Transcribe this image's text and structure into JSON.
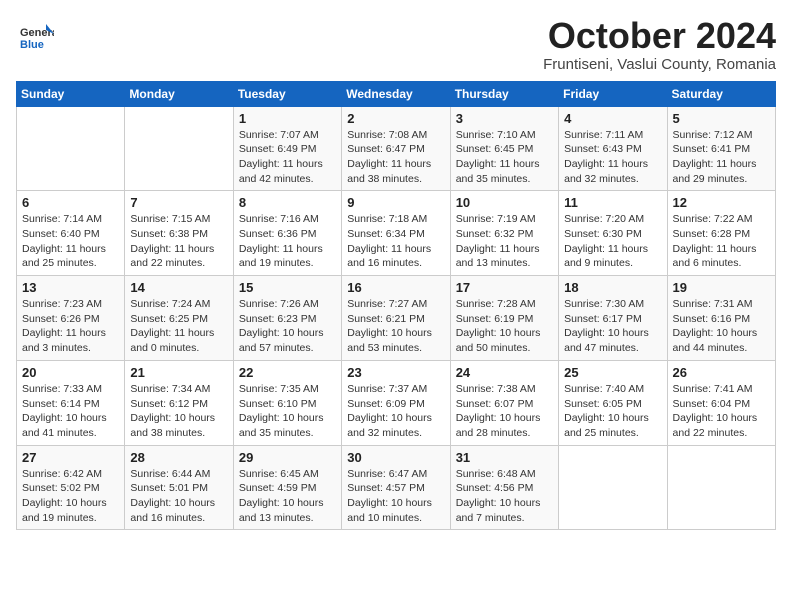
{
  "logo": {
    "general": "General",
    "blue": "Blue"
  },
  "header": {
    "month": "October 2024",
    "location": "Fruntiseni, Vaslui County, Romania"
  },
  "weekdays": [
    "Sunday",
    "Monday",
    "Tuesday",
    "Wednesday",
    "Thursday",
    "Friday",
    "Saturday"
  ],
  "weeks": [
    [
      {
        "day": "",
        "info": ""
      },
      {
        "day": "",
        "info": ""
      },
      {
        "day": "1",
        "info": "Sunrise: 7:07 AM\nSunset: 6:49 PM\nDaylight: 11 hours and 42 minutes."
      },
      {
        "day": "2",
        "info": "Sunrise: 7:08 AM\nSunset: 6:47 PM\nDaylight: 11 hours and 38 minutes."
      },
      {
        "day": "3",
        "info": "Sunrise: 7:10 AM\nSunset: 6:45 PM\nDaylight: 11 hours and 35 minutes."
      },
      {
        "day": "4",
        "info": "Sunrise: 7:11 AM\nSunset: 6:43 PM\nDaylight: 11 hours and 32 minutes."
      },
      {
        "day": "5",
        "info": "Sunrise: 7:12 AM\nSunset: 6:41 PM\nDaylight: 11 hours and 29 minutes."
      }
    ],
    [
      {
        "day": "6",
        "info": "Sunrise: 7:14 AM\nSunset: 6:40 PM\nDaylight: 11 hours and 25 minutes."
      },
      {
        "day": "7",
        "info": "Sunrise: 7:15 AM\nSunset: 6:38 PM\nDaylight: 11 hours and 22 minutes."
      },
      {
        "day": "8",
        "info": "Sunrise: 7:16 AM\nSunset: 6:36 PM\nDaylight: 11 hours and 19 minutes."
      },
      {
        "day": "9",
        "info": "Sunrise: 7:18 AM\nSunset: 6:34 PM\nDaylight: 11 hours and 16 minutes."
      },
      {
        "day": "10",
        "info": "Sunrise: 7:19 AM\nSunset: 6:32 PM\nDaylight: 11 hours and 13 minutes."
      },
      {
        "day": "11",
        "info": "Sunrise: 7:20 AM\nSunset: 6:30 PM\nDaylight: 11 hours and 9 minutes."
      },
      {
        "day": "12",
        "info": "Sunrise: 7:22 AM\nSunset: 6:28 PM\nDaylight: 11 hours and 6 minutes."
      }
    ],
    [
      {
        "day": "13",
        "info": "Sunrise: 7:23 AM\nSunset: 6:26 PM\nDaylight: 11 hours and 3 minutes."
      },
      {
        "day": "14",
        "info": "Sunrise: 7:24 AM\nSunset: 6:25 PM\nDaylight: 11 hours and 0 minutes."
      },
      {
        "day": "15",
        "info": "Sunrise: 7:26 AM\nSunset: 6:23 PM\nDaylight: 10 hours and 57 minutes."
      },
      {
        "day": "16",
        "info": "Sunrise: 7:27 AM\nSunset: 6:21 PM\nDaylight: 10 hours and 53 minutes."
      },
      {
        "day": "17",
        "info": "Sunrise: 7:28 AM\nSunset: 6:19 PM\nDaylight: 10 hours and 50 minutes."
      },
      {
        "day": "18",
        "info": "Sunrise: 7:30 AM\nSunset: 6:17 PM\nDaylight: 10 hours and 47 minutes."
      },
      {
        "day": "19",
        "info": "Sunrise: 7:31 AM\nSunset: 6:16 PM\nDaylight: 10 hours and 44 minutes."
      }
    ],
    [
      {
        "day": "20",
        "info": "Sunrise: 7:33 AM\nSunset: 6:14 PM\nDaylight: 10 hours and 41 minutes."
      },
      {
        "day": "21",
        "info": "Sunrise: 7:34 AM\nSunset: 6:12 PM\nDaylight: 10 hours and 38 minutes."
      },
      {
        "day": "22",
        "info": "Sunrise: 7:35 AM\nSunset: 6:10 PM\nDaylight: 10 hours and 35 minutes."
      },
      {
        "day": "23",
        "info": "Sunrise: 7:37 AM\nSunset: 6:09 PM\nDaylight: 10 hours and 32 minutes."
      },
      {
        "day": "24",
        "info": "Sunrise: 7:38 AM\nSunset: 6:07 PM\nDaylight: 10 hours and 28 minutes."
      },
      {
        "day": "25",
        "info": "Sunrise: 7:40 AM\nSunset: 6:05 PM\nDaylight: 10 hours and 25 minutes."
      },
      {
        "day": "26",
        "info": "Sunrise: 7:41 AM\nSunset: 6:04 PM\nDaylight: 10 hours and 22 minutes."
      }
    ],
    [
      {
        "day": "27",
        "info": "Sunrise: 6:42 AM\nSunset: 5:02 PM\nDaylight: 10 hours and 19 minutes."
      },
      {
        "day": "28",
        "info": "Sunrise: 6:44 AM\nSunset: 5:01 PM\nDaylight: 10 hours and 16 minutes."
      },
      {
        "day": "29",
        "info": "Sunrise: 6:45 AM\nSunset: 4:59 PM\nDaylight: 10 hours and 13 minutes."
      },
      {
        "day": "30",
        "info": "Sunrise: 6:47 AM\nSunset: 4:57 PM\nDaylight: 10 hours and 10 minutes."
      },
      {
        "day": "31",
        "info": "Sunrise: 6:48 AM\nSunset: 4:56 PM\nDaylight: 10 hours and 7 minutes."
      },
      {
        "day": "",
        "info": ""
      },
      {
        "day": "",
        "info": ""
      }
    ]
  ]
}
